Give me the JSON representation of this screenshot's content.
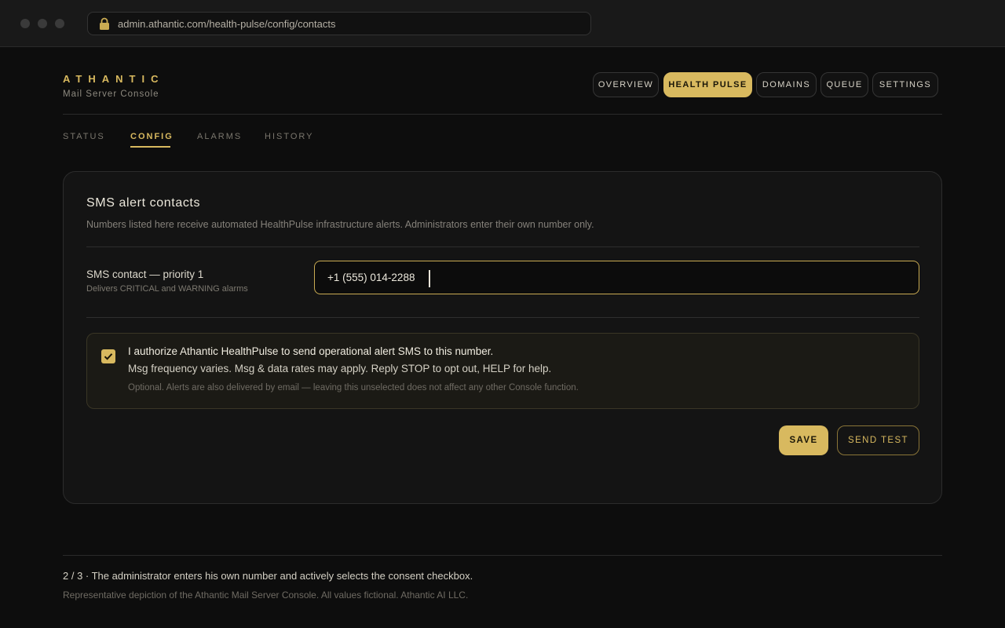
{
  "browser": {
    "url": "admin.athantic.com/health-pulse/config/contacts"
  },
  "header": {
    "brand": "ATHANTIC",
    "subtitle": "Mail Server Console",
    "nav": [
      {
        "label": "OVERVIEW",
        "active": false
      },
      {
        "label": "HEALTH PULSE",
        "active": true
      },
      {
        "label": "DOMAINS",
        "active": false
      },
      {
        "label": "QUEUE",
        "active": false
      },
      {
        "label": "SETTINGS",
        "active": false
      }
    ]
  },
  "subtabs": [
    {
      "label": "STATUS",
      "active": false
    },
    {
      "label": "CONFIG",
      "active": true
    },
    {
      "label": "ALARMS",
      "active": false
    },
    {
      "label": "HISTORY",
      "active": false
    }
  ],
  "card": {
    "title": "SMS alert contacts",
    "description": "Numbers listed here receive automated HealthPulse infrastructure alerts. Administrators enter their own number only.",
    "field": {
      "label": "SMS contact — priority 1",
      "sublabel": "Delivers CRITICAL and WARNING alarms",
      "value": "+1 (555) 014-2288"
    },
    "consent": {
      "checked": true,
      "line1": "I authorize Athantic HealthPulse to send operational alert SMS to this number.",
      "line2": "Msg frequency varies. Msg & data rates may apply. Reply STOP to opt out, HELP for help.",
      "line3": "Optional. Alerts are also delivered by email — leaving this unselected does not affect any other Console function."
    },
    "buttons": {
      "save": "SAVE",
      "send_test": "SEND TEST"
    }
  },
  "footer": {
    "caption": "2 / 3 · The administrator enters his own number and actively selects the consent checkbox.",
    "note": "Representative depiction of the Athantic Mail Server Console. All values fictional. Athantic AI LLC."
  },
  "colors": {
    "accent": "#d8b95f",
    "background": "#0d0d0d",
    "card": "#141414"
  }
}
